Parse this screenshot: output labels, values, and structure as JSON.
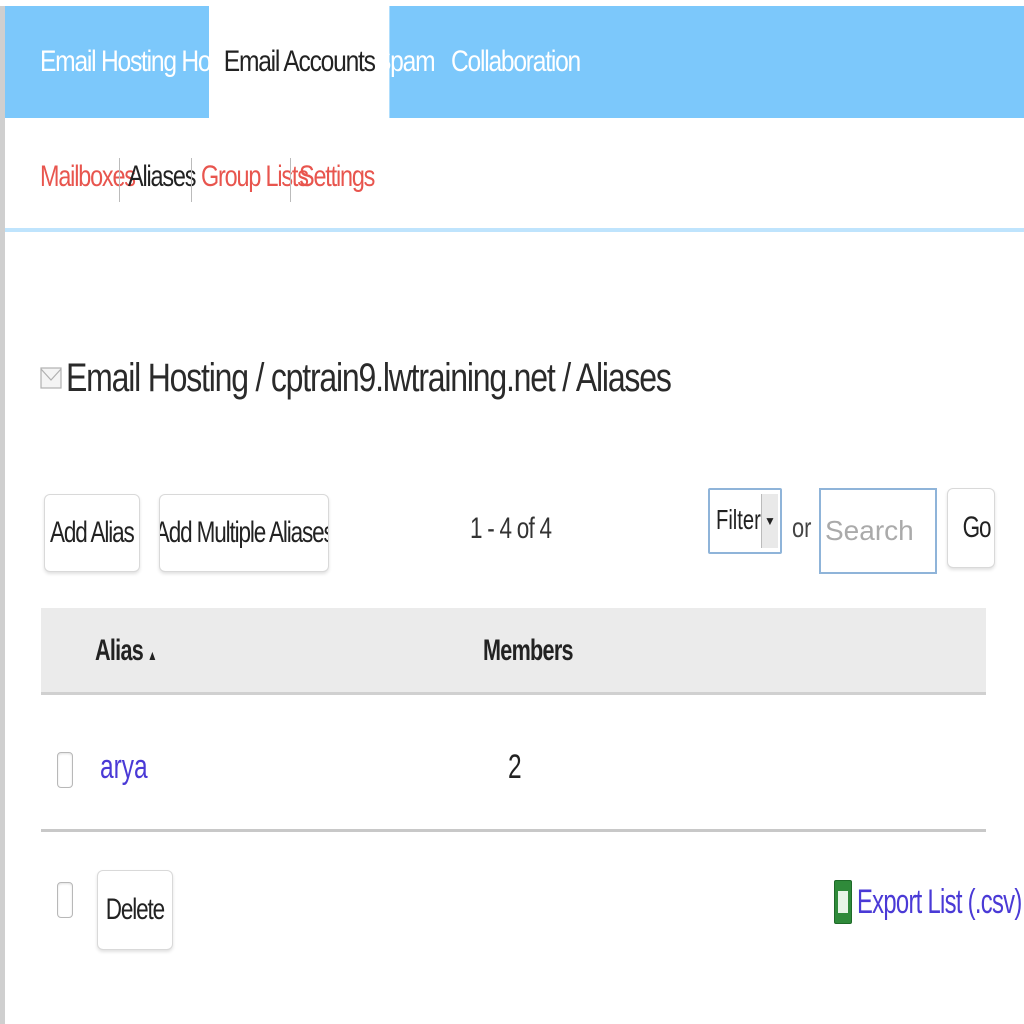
{
  "topnav": {
    "tabs": [
      {
        "label": "Email Hosting Home"
      },
      {
        "label": "Email Accounts"
      },
      {
        "label": "Spam"
      },
      {
        "label": "Collaboration"
      }
    ]
  },
  "subnav": {
    "items": [
      {
        "label": "Mailboxes"
      },
      {
        "label": "Aliases"
      },
      {
        "label": "Group Lists"
      },
      {
        "label": "Settings"
      }
    ]
  },
  "breadcrumb": {
    "text": "Email Hosting / cptrain9.lwtraining.net / Aliases"
  },
  "toolbar": {
    "add_alias_label": "Add Alias",
    "add_multiple_label": "Add Multiple Aliases",
    "count_text": "1 - 4 of 4",
    "filter_value": "Filter",
    "or_text": "or",
    "search_placeholder": "Search",
    "go_label": "Go"
  },
  "table": {
    "headers": {
      "alias": "Alias",
      "members": "Members"
    },
    "sort_indicator": "▲",
    "rows": [
      {
        "alias": "arya",
        "members": "2"
      }
    ]
  },
  "footer": {
    "delete_label": "Delete",
    "export_label": "Export List (.csv)"
  },
  "colors": {
    "nav_bg": "#7cc8fb",
    "link_red": "#e8554e",
    "link_blue": "#4a3ad6"
  }
}
